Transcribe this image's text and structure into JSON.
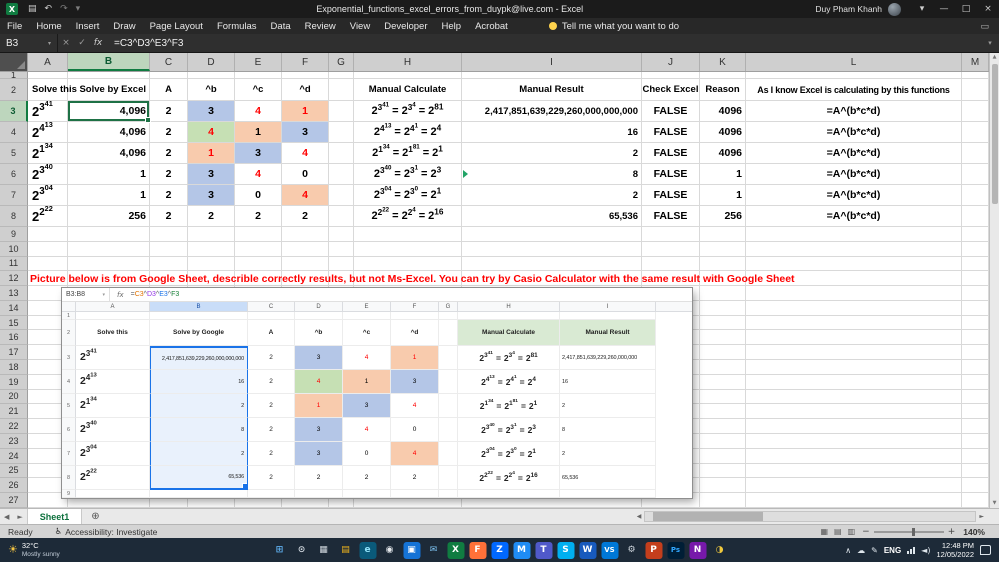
{
  "icons": {
    "app": "X",
    "save": "▤",
    "undo": "↶",
    "redo": "↷",
    "caret": "▾",
    "minimize": "—",
    "maximize": "□",
    "close": "×",
    "cancel": "×",
    "enter": "✓",
    "fx": "fx",
    "sun": "☀",
    "cloud": "☁",
    "chevron_up": "∧",
    "pen": "✎",
    "access": "♿",
    "add_sheet": "⊕",
    "left": "◀",
    "right": "►",
    "up": "▲",
    "down": "▼",
    "view_normal": "▦",
    "view_layout": "▤",
    "view_break": "▥",
    "zoom_minus": "−",
    "zoom_plus": "+",
    "vol": "◄)",
    "comment": "▭"
  },
  "title_bar": {
    "title": "Exponential_functions_excel_errors_from_duypk@live.com - Excel",
    "user": "Duy Pham Khanh"
  },
  "ribbon": {
    "tabs": [
      "File",
      "Home",
      "Insert",
      "Draw",
      "Page Layout",
      "Formulas",
      "Data",
      "Review",
      "View",
      "Developer",
      "Help",
      "Acrobat"
    ],
    "tell_me": "Tell me what you want to do"
  },
  "formula_bar": {
    "name_box": "B3",
    "formula": "=C3^D3^E3^F3"
  },
  "grid": {
    "columns": [
      "A",
      "B",
      "C",
      "D",
      "E",
      "F",
      "G",
      "H",
      "I",
      "J",
      "K",
      "L",
      "M"
    ],
    "selected_cell": "B3",
    "header_labels": {
      "A": "Solve this",
      "B": "Solve by Excel",
      "C": "A",
      "D": "^b",
      "E": "^c",
      "F": "^d",
      "H": "Manual Calculate",
      "I": "Manual Result",
      "J": "Check Excel",
      "K": "Reason",
      "L": "As I know Excel is calculating by this functions"
    },
    "rows": [
      {
        "solve": {
          "b": "2",
          "s": "3",
          "ss": "41"
        },
        "excel": "4,096",
        "base": "2",
        "bcd": [
          {
            "v": "3",
            "st": "blue"
          },
          {
            "v": "4",
            "st": "red"
          },
          {
            "v": "1",
            "st": "orange-red"
          }
        ],
        "calc": [
          {
            "b": "2",
            "s": "3",
            "ss": "41"
          },
          {
            "b": "2",
            "s": "3",
            "ss": "4"
          },
          {
            "b": "2",
            "s": "81"
          }
        ],
        "result": "2,417,851,639,229,260,000,000,000",
        "check": "FALSE",
        "reason": "4096",
        "func": "=A^(b*c*d)",
        "google": "2,417,851,639,229,260,000,000,000",
        "gresult": "2,417,851,639,229,260,000,000"
      },
      {
        "solve": {
          "b": "2",
          "s": "4",
          "ss": "13"
        },
        "excel": "4,096",
        "base": "2",
        "bcd": [
          {
            "v": "4",
            "st": "green-red"
          },
          {
            "v": "1",
            "st": "orange"
          },
          {
            "v": "3",
            "st": "blue"
          }
        ],
        "calc": [
          {
            "b": "2",
            "s": "4",
            "ss": "13"
          },
          {
            "b": "2",
            "s": "4",
            "ss": "1"
          },
          {
            "b": "2",
            "s": "4"
          }
        ],
        "result": "16",
        "check": "FALSE",
        "reason": "4096",
        "func": "=A^(b*c*d)",
        "google": "16",
        "gresult": "16"
      },
      {
        "solve": {
          "b": "2",
          "s": "1",
          "ss": "34"
        },
        "excel": "4,096",
        "base": "2",
        "bcd": [
          {
            "v": "1",
            "st": "orange-red"
          },
          {
            "v": "3",
            "st": "blue"
          },
          {
            "v": "4",
            "st": "red"
          }
        ],
        "calc": [
          {
            "b": "2",
            "s": "1",
            "ss": "34"
          },
          {
            "b": "2",
            "s": "1",
            "ss": "81"
          },
          {
            "b": "2",
            "s": "1"
          }
        ],
        "result": "2",
        "check": "FALSE",
        "reason": "4096",
        "func": "=A^(b*c*d)",
        "google": "2",
        "gresult": "2"
      },
      {
        "solve": {
          "b": "2",
          "s": "3",
          "ss": "40"
        },
        "excel": "1",
        "base": "2",
        "bcd": [
          {
            "v": "3",
            "st": "blue"
          },
          {
            "v": "4",
            "st": "red"
          },
          {
            "v": "0",
            "st": "plain"
          }
        ],
        "calc": [
          {
            "b": "2",
            "s": "3",
            "ss": "40"
          },
          {
            "b": "2",
            "s": "3",
            "ss": "1"
          },
          {
            "b": "2",
            "s": "3"
          }
        ],
        "result": "8",
        "check": "FALSE",
        "reason": "1",
        "func": "=A^(b*c*d)",
        "google": "8",
        "gresult": "8"
      },
      {
        "solve": {
          "b": "2",
          "s": "3",
          "ss": "04"
        },
        "excel": "1",
        "base": "2",
        "bcd": [
          {
            "v": "3",
            "st": "blue"
          },
          {
            "v": "0",
            "st": "plain"
          },
          {
            "v": "4",
            "st": "orange-red"
          }
        ],
        "calc": [
          {
            "b": "2",
            "s": "3",
            "ss": "04"
          },
          {
            "b": "2",
            "s": "3",
            "ss": "0"
          },
          {
            "b": "2",
            "s": "1"
          }
        ],
        "result": "2",
        "check": "FALSE",
        "reason": "1",
        "func": "=A^(b*c*d)",
        "google": "2",
        "gresult": "2"
      },
      {
        "solve": {
          "b": "2",
          "s": "2",
          "ss": "22"
        },
        "excel": "256",
        "base": "2",
        "bcd": [
          {
            "v": "2",
            "st": "plain"
          },
          {
            "v": "2",
            "st": "plain"
          },
          {
            "v": "2",
            "st": "plain"
          }
        ],
        "calc": [
          {
            "b": "2",
            "s": "2",
            "ss": "22"
          },
          {
            "b": "2",
            "s": "2",
            "ss": "4"
          },
          {
            "b": "2",
            "s": "16"
          }
        ],
        "result": "65,536",
        "check": "FALSE",
        "reason": "256",
        "func": "=A^(b*c*d)",
        "google": "65,536",
        "gresult": "65,536"
      }
    ],
    "note": "Picture below is from Google Sheet, describle correctly results, but not Ms-Excel. You can try by Casio Calculator with the same result with Google Sheet",
    "colors": {
      "blue": "#b4c6e7",
      "orange": "#f8cbad",
      "green": "#c6e0b4",
      "red_text": "#ff0000",
      "selection": "#1e7145"
    }
  },
  "embedded_sheet": {
    "name_box": "B3:B8",
    "columns": [
      "A",
      "B",
      "C",
      "D",
      "E",
      "F",
      "G",
      "H",
      "I"
    ],
    "header_labels": {
      "A": "Solve this",
      "B": "Solve by Google",
      "C": "A",
      "D": "^b",
      "E": "^c",
      "F": "^d",
      "H": "Manual Calculate",
      "I": "Manual Result"
    },
    "formula_parts": [
      {
        "t": "=",
        "c": "#5f6368"
      },
      {
        "t": "C3",
        "c": "#e37400"
      },
      {
        "t": "^",
        "c": "#5f6368"
      },
      {
        "t": "D3",
        "c": "#9334e6"
      },
      {
        "t": "^",
        "c": "#5f6368"
      },
      {
        "t": "E3",
        "c": "#1a73e8"
      },
      {
        "t": "^",
        "c": "#5f6368"
      },
      {
        "t": "F3",
        "c": "#188038"
      }
    ]
  },
  "sheet_tabs": {
    "active": "Sheet1"
  },
  "status_bar": {
    "mode": "Ready",
    "accessibility": "Accessibility: Investigate",
    "zoom": "140%"
  },
  "taskbar": {
    "weather_temp": "32°C",
    "weather_desc": "Mostly sunny",
    "icons": [
      {
        "name": "start",
        "g": "⊞",
        "bg": "transparent",
        "fg": "#5fb0f0"
      },
      {
        "name": "search",
        "g": "⊙",
        "bg": "transparent",
        "fg": "#cfd6dd"
      },
      {
        "name": "task-view",
        "g": "▦",
        "bg": "transparent",
        "fg": "#cfd6dd"
      },
      {
        "name": "file-explorer",
        "g": "▤",
        "bg": "transparent",
        "fg": "#f3b71d"
      },
      {
        "name": "edge",
        "g": "e",
        "bg": "#0a5a7a",
        "fg": "#8fe0f7"
      },
      {
        "name": "chrome",
        "g": "◉",
        "bg": "transparent",
        "fg": "#e6eaee"
      },
      {
        "name": "store",
        "g": "▣",
        "bg": "#1573d6",
        "fg": "#ffffff"
      },
      {
        "name": "mail",
        "g": "✉",
        "bg": "transparent",
        "fg": "#7cc1ef"
      },
      {
        "name": "excel",
        "g": "X",
        "bg": "#107c41",
        "fg": "#ffffff"
      },
      {
        "name": "firefox",
        "g": "F",
        "bg": "#ff7139",
        "fg": "#ffffff"
      },
      {
        "name": "zalo",
        "g": "Z",
        "bg": "#0068ff",
        "fg": "#ffffff"
      },
      {
        "name": "messenger",
        "g": "M",
        "bg": "#1f8cf5",
        "fg": "#ffffff"
      },
      {
        "name": "teams",
        "g": "T",
        "bg": "#5059c9",
        "fg": "#ffffff"
      },
      {
        "name": "skype",
        "g": "S",
        "bg": "#00aff0",
        "fg": "#ffffff"
      },
      {
        "name": "word",
        "g": "W",
        "bg": "#185abd",
        "fg": "#ffffff"
      },
      {
        "name": "vscode",
        "g": "VS",
        "bg": "#0078d7",
        "fg": "#ffffff"
      },
      {
        "name": "settings",
        "g": "⚙",
        "bg": "transparent",
        "fg": "#cfd6dd"
      },
      {
        "name": "powerpoint",
        "g": "P",
        "bg": "#c43e1c",
        "fg": "#ffffff"
      },
      {
        "name": "photoshop",
        "g": "Ps",
        "bg": "#001e36",
        "fg": "#31a8ff"
      },
      {
        "name": "onenote",
        "g": "N",
        "bg": "#7719aa",
        "fg": "#ffffff"
      },
      {
        "name": "paint",
        "g": "◑",
        "bg": "transparent",
        "fg": "#f0c93d"
      }
    ],
    "tray_lang": "ENG",
    "time": "12:48 PM",
    "date": "12/05/2022"
  }
}
